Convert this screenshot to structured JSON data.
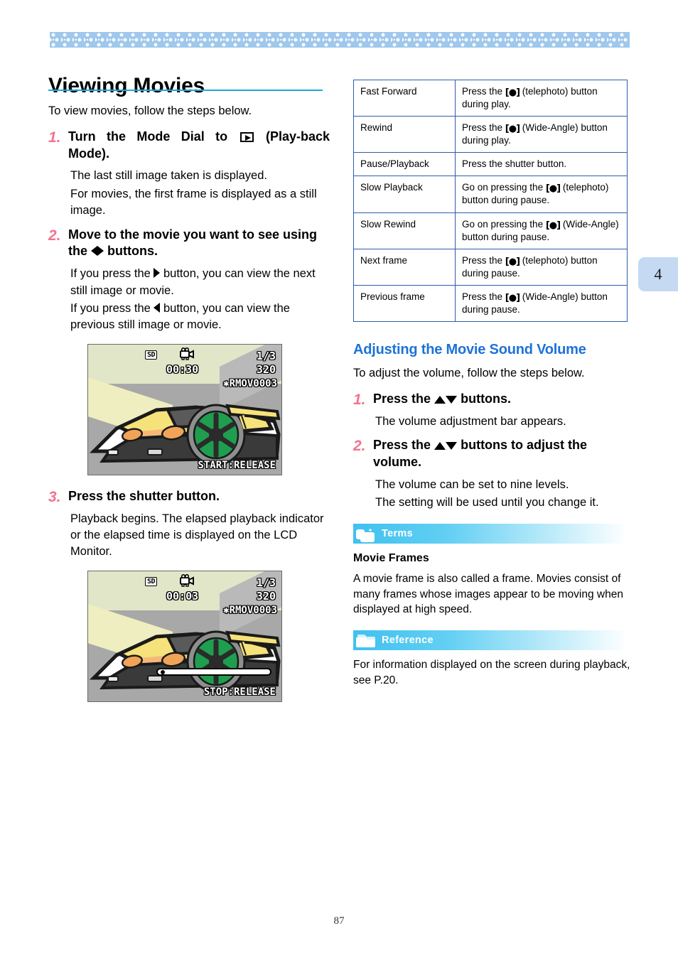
{
  "document": {
    "page_number": "87",
    "chapter_tab": "4",
    "title": "Viewing Movies",
    "accent_rule_color": "#19a9e0",
    "step_number_color": "#f4718f",
    "subhead_color": "#1d72d8",
    "table_border_color": "#2b5fa8",
    "chapter_tab_color": "#c5d9f2",
    "top_band_color": "#9fc8ec"
  },
  "left_column": {
    "intro": "To view movies, follow the steps below.",
    "steps": [
      {
        "number": "1.",
        "heading_a": "Turn the Mode Dial to",
        "heading_icon": "playback-mode-icon",
        "heading_b": "(Play-back Mode).",
        "body": [
          "The last still image taken is displayed.",
          "For movies, the first frame is displayed as a still image."
        ]
      },
      {
        "number": "2.",
        "heading_a": "Move to the movie you want to see using the",
        "heading_icon": "left-right-arrow-buttons-icon",
        "heading_b": "buttons.",
        "body_a1": "If you press the",
        "body_a2": "button, you can view the next still image or movie.",
        "body_b1": "If you press the",
        "body_b2": "button, you can view the previous still image or movie."
      },
      {
        "number": "3.",
        "heading_a": "Press the shutter button.",
        "body": [
          "Playback begins. The elapsed playback indicator or the elapsed time is displayed on the LCD Monitor."
        ]
      }
    ],
    "lcd_screens": [
      {
        "name": "movie-first-frame-screen",
        "sd": "SD",
        "camera_icon": "movie-camera-icon",
        "frame_counter": "1/3",
        "elapsed": "00:30",
        "resolution": "320",
        "filename": "✱RMOV0003",
        "bottom_hint": "START:RELEASE",
        "progress_visible": false
      },
      {
        "name": "movie-playback-screen",
        "sd": "SD",
        "camera_icon": "movie-camera-icon",
        "frame_counter": "1/3",
        "elapsed": "00:03",
        "resolution": "320",
        "filename": "✱RMOV0003",
        "bottom_hint": "STOP:RELEASE",
        "progress_visible": true
      }
    ]
  },
  "right_column": {
    "operations_table": {
      "rows": [
        {
          "operation": "Fast Forward",
          "action_pre": "Press the",
          "action_icon": "telephoto-zoom-icon",
          "action_post": "(telephoto) button during play."
        },
        {
          "operation": "Rewind",
          "action_pre": "Press the",
          "action_icon": "wide-angle-zoom-icon",
          "action_post": "(Wide-Angle) button during play."
        },
        {
          "operation": "Pause/Playback",
          "action_pre": "Press the shutter button.",
          "action_icon": "",
          "action_post": ""
        },
        {
          "operation": "Slow Playback",
          "action_pre": "Go on pressing the",
          "action_icon": "telephoto-zoom-icon",
          "action_post": "(telephoto) button during pause."
        },
        {
          "operation": "Slow Rewind",
          "action_pre": "Go on pressing the",
          "action_icon": "wide-angle-zoom-icon",
          "action_post": "(Wide-Angle) button during pause."
        },
        {
          "operation": "Next frame",
          "action_pre": "Press the",
          "action_icon": "telephoto-zoom-icon",
          "action_post": "(telephoto) button during pause."
        },
        {
          "operation": "Previous frame",
          "action_pre": "Press the",
          "action_icon": "wide-angle-zoom-icon",
          "action_post": "(Wide-Angle) button during pause."
        }
      ]
    },
    "subhead": "Adjusting the Movie Sound Volume",
    "intro": "To adjust the volume, follow the steps below.",
    "steps": [
      {
        "number": "1.",
        "heading_a": "Press the",
        "heading_icon": "up-down-arrow-buttons-icon",
        "heading_b": "buttons.",
        "body": [
          "The volume adjustment bar appears."
        ]
      },
      {
        "number": "2.",
        "heading_a": "Press the",
        "heading_icon": "up-down-arrow-buttons-icon",
        "heading_b": "buttons to adjust the volume.",
        "body": [
          "The volume can be set to nine levels.",
          "The setting will be used until you change it."
        ]
      }
    ],
    "callouts": [
      {
        "label": "Terms",
        "icon": "terms-speech-bubble-icon",
        "title": "Movie Frames",
        "text": "A movie frame is also called a frame. Movies consist of many frames whose images appear to be moving when displayed at high speed."
      },
      {
        "label": "Reference",
        "icon": "reference-folder-icon",
        "title": "",
        "text": "For information displayed on the screen during playback, see P.20."
      }
    ]
  }
}
